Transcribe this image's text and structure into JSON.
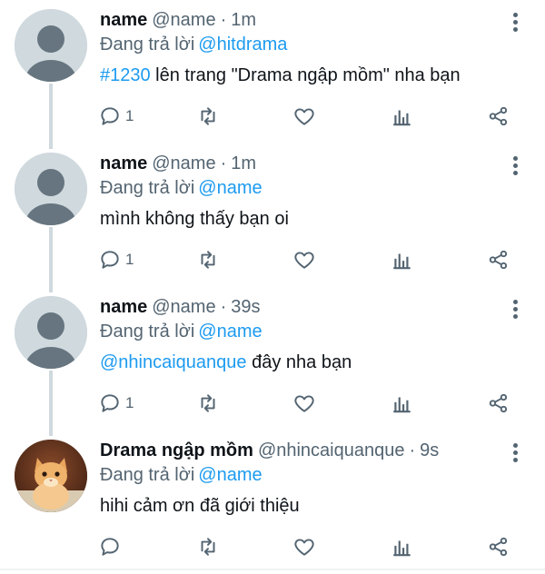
{
  "colors": {
    "accent": "#1d9bf0",
    "secondary": "#536471",
    "text": "#0f1419",
    "thread": "#cfd9de"
  },
  "tweets": [
    {
      "name": "name",
      "handle": "@name",
      "sep": "·",
      "time": "1m",
      "reply_prefix": "Đang trả lời",
      "reply_to": "@hitdrama",
      "body_link": "#1230",
      "body_text": " lên trang \"Drama ngập mồm\" nha bạn",
      "reply_count": "1",
      "avatar": "default-avatar"
    },
    {
      "name": "name",
      "handle": "@name",
      "sep": "·",
      "time": "1m",
      "reply_prefix": "Đang trả lời",
      "reply_to": "@name",
      "body_link": "",
      "body_text": "mình không thấy bạn oi",
      "reply_count": "1",
      "avatar": "default-avatar"
    },
    {
      "name": "name",
      "handle": "@name",
      "sep": "·",
      "time": "39s",
      "reply_prefix": "Đang trả lời",
      "reply_to": "@name",
      "body_link": "@nhincaiquanque",
      "body_text": " đây nha bạn",
      "reply_count": "1",
      "avatar": "default-avatar"
    },
    {
      "name": "Drama ngập mồm",
      "handle": "@nhincaiquanque",
      "sep": "·",
      "time": "9s",
      "reply_prefix": "Đang trả lời",
      "reply_to": "@name",
      "body_link": "",
      "body_text": "hihi cảm ơn đã giới thiệu",
      "reply_count": "",
      "avatar": "cat-photo-avatar"
    }
  ]
}
